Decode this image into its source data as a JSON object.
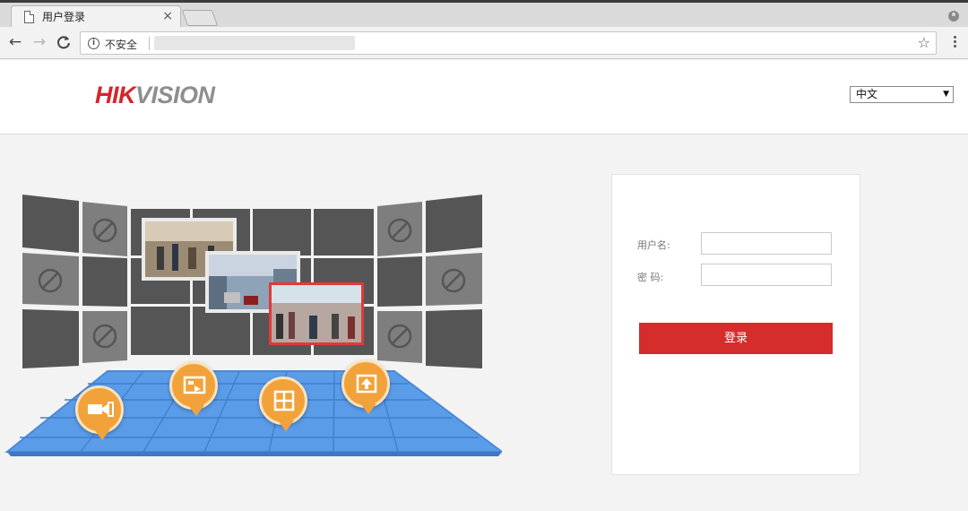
{
  "browser": {
    "tab_title": "用户登录",
    "tab_close": "×",
    "security_label": "不安全",
    "nav_back": "←",
    "nav_forward": "→",
    "nav_reload": "C",
    "bookmark_star": "☆"
  },
  "header": {
    "brand_part1": "HIK",
    "brand_part2": "VISION",
    "language_selected": "中文"
  },
  "login": {
    "username_label": "用户名:",
    "password_label": "密  码:",
    "username_value": "",
    "password_value": "",
    "submit_label": "登录"
  },
  "colors": {
    "brand_red": "#d4262b",
    "button_red": "#d42d2c",
    "floor_blue": "#5b9ce8",
    "pin_orange": "#f2a23a"
  },
  "illustration_icons": [
    "camera-icon",
    "video-playback-icon",
    "grid-layout-icon",
    "upload-icon"
  ]
}
